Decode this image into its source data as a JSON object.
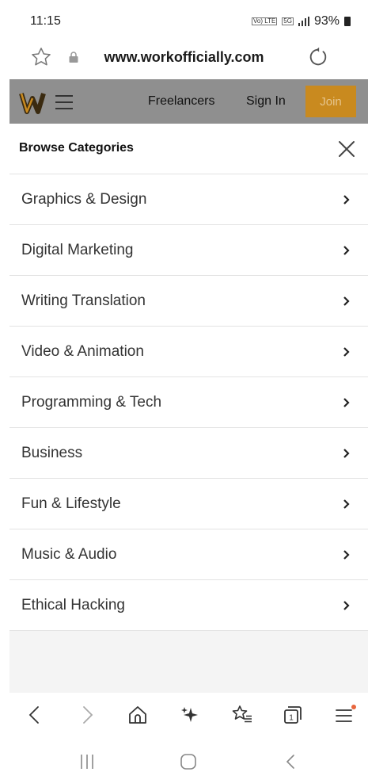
{
  "status_bar": {
    "time": "11:15",
    "network_badge_1": "Vo) LTE",
    "network_badge_2": "5G",
    "battery": "93%"
  },
  "address_bar": {
    "url": "www.workofficially.com"
  },
  "site_header": {
    "nav_freelancers": "Freelancers",
    "nav_sign_in": "Sign In",
    "join_label": "Join",
    "colors": {
      "header_bg": "#8f8f8f",
      "join_bg": "#c98a1f",
      "join_text": "#e6c58d"
    }
  },
  "categories": {
    "title": "Browse Categories",
    "items": [
      {
        "label": "Graphics & Design"
      },
      {
        "label": "Digital Marketing"
      },
      {
        "label": "Writing Translation"
      },
      {
        "label": "Video & Animation"
      },
      {
        "label": "Programming & Tech"
      },
      {
        "label": "Business"
      },
      {
        "label": "Fun & Lifestyle"
      },
      {
        "label": "Music & Audio"
      },
      {
        "label": "Ethical Hacking"
      }
    ]
  },
  "toolbar": {
    "icons": [
      "back-icon",
      "forward-icon",
      "home-icon",
      "sparkle-icon",
      "bookmarks-icon",
      "tabs-icon",
      "menu-icon"
    ],
    "tab_count": "1",
    "notification_color": "#e8663d"
  }
}
